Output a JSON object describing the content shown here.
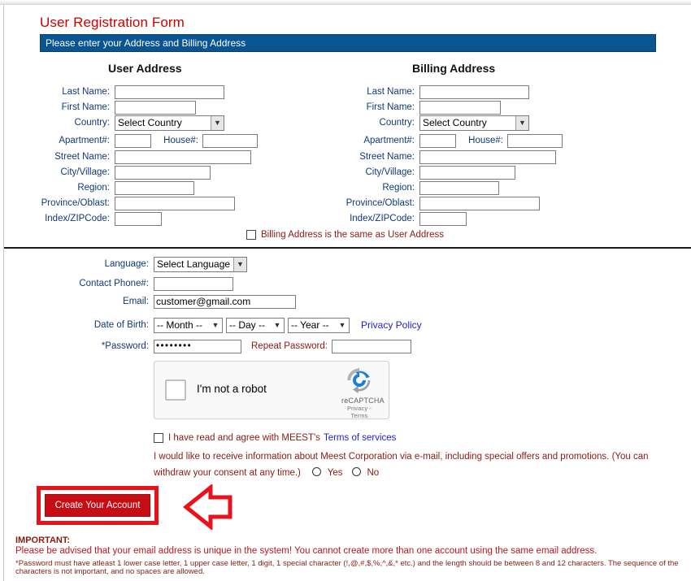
{
  "page": {
    "title": "User Registration Form",
    "banner": "Please enter your Address and Billing Address"
  },
  "user_address": {
    "heading": "User Address",
    "fields": {
      "last_name": "Last Name:",
      "first_name": "First Name:",
      "country": "Country:",
      "apartment": "Apartment#:",
      "house": "House#:",
      "street": "Street Name:",
      "city": "City/Village:",
      "region": "Region:",
      "province": "Province/Oblast:",
      "zip": "Index/ZIPCode:"
    },
    "values": {
      "last_name": "",
      "first_name": "",
      "country": "Select Country",
      "apartment": "",
      "house": "",
      "street": "",
      "city": "",
      "region": "",
      "province": "",
      "zip": ""
    }
  },
  "billing_address": {
    "heading": "Billing Address",
    "fields": {
      "last_name": "Last Name:",
      "first_name": "First Name:",
      "country": "Country:",
      "apartment": "Apartment#:",
      "house": "House#:",
      "street": "Street Name:",
      "city": "City/Village:",
      "region": "Region:",
      "province": "Province/Oblast:",
      "zip": "Index/ZIPCode:"
    },
    "values": {
      "last_name": "",
      "first_name": "",
      "country": "Select Country",
      "apartment": "",
      "house": "",
      "street": "",
      "city": "",
      "region": "",
      "province": "",
      "zip": ""
    }
  },
  "same_address": {
    "label": "Billing Address is the same as User Address",
    "checked": false
  },
  "account": {
    "language_label": "Language:",
    "language_value": "Select Language",
    "phone_label": "Contact Phone#:",
    "phone_value": "",
    "email_label": "Email:",
    "email_value": "customer@gmail.com",
    "dob_label": "Date of Birth:",
    "dob_month": "-- Month --",
    "dob_day": "-- Day --",
    "dob_year": "-- Year --",
    "privacy_policy": "Privacy Policy",
    "password_label": "*Password:",
    "password_value": "••••••••",
    "repeat_password_label": "Repeat Password:",
    "repeat_password_value": ""
  },
  "recaptcha": {
    "checkbox_label": "I'm not a robot",
    "brand": "reCAPTCHA",
    "terms": "Privacy - Terms",
    "checked": false
  },
  "terms": {
    "prefix": "I have read and agree with MEEST's",
    "link": "Terms of services",
    "checked": false
  },
  "marketing": {
    "text": "I would like to receive information about Meest Corporation via e-mail, including special offers and promotions. (You can withdraw your consent at any time.)",
    "yes_label": "Yes",
    "no_label": "No",
    "selected": ""
  },
  "submit": {
    "label": "Create Your Account"
  },
  "important": {
    "heading": "IMPORTANT:",
    "line1": "Please be advised that your email address is unique in the system! You cannot create more than one account using the same email address.",
    "line2": "*Password must have atleast 1 lower case letter, 1 upper case letter, 1 digit, 1 special character (!,@,#,$,%,^,&,* etc.) and the length should be between 8 and 12 characters. The sequence of the characters is not important, and no spaces are allowed."
  },
  "colors": {
    "title_red": "#CC0000",
    "banner_blue": "#0A5591",
    "label_navy": "#103A78",
    "accent_red": "#E8121A",
    "button_red": "#C60C14",
    "link_blue": "#2222CC"
  }
}
